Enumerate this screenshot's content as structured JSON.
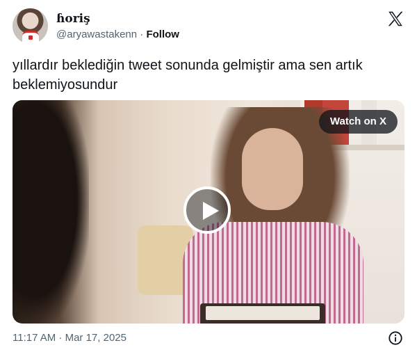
{
  "user": {
    "name": "ɦoriş",
    "handle": "@aryawastakenn",
    "separator": "·",
    "follow_label": "Follow",
    "avatar_icon": "profile-avatar"
  },
  "tweet": {
    "text": "yıllardır beklediğin tweet sonunda gelmiştir ama sen artık beklemiyosundur"
  },
  "media": {
    "watch_label": "Watch on X",
    "play_icon": "play-icon"
  },
  "footer": {
    "timestamp": "11:17 AM · Mar 17, 2025",
    "info_icon": "info-icon"
  },
  "colors": {
    "text": "#0f1419",
    "secondary": "#536471",
    "overlay": "#0f1419"
  }
}
